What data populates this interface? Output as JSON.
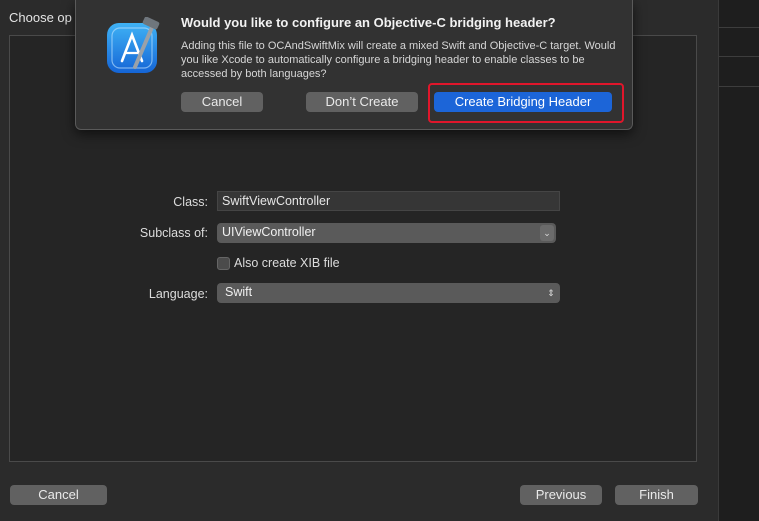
{
  "window": {
    "title": "Choose op"
  },
  "form": {
    "class_label": "Class:",
    "class_value": "SwiftViewController",
    "subclass_label": "Subclass of:",
    "subclass_value": "UIViewController",
    "xib_label": "Also create XIB file",
    "xib_checked": false,
    "language_label": "Language:",
    "language_value": "Swift"
  },
  "footer": {
    "cancel": "Cancel",
    "previous": "Previous",
    "finish": "Finish"
  },
  "dialog": {
    "title": "Would you like to configure an Objective-C bridging header?",
    "message": "Adding this file to OCAndSwiftMix will create a mixed Swift and Objective-C target. Would you like Xcode to automatically configure a bridging header to enable classes to be accessed by both languages?",
    "cancel": "Cancel",
    "dont_create": "Don’t Create",
    "create": "Create Bridging Header",
    "icon": "xcode-app-icon"
  },
  "colors": {
    "accent": "#1c65d8",
    "highlight": "#e0162b"
  }
}
